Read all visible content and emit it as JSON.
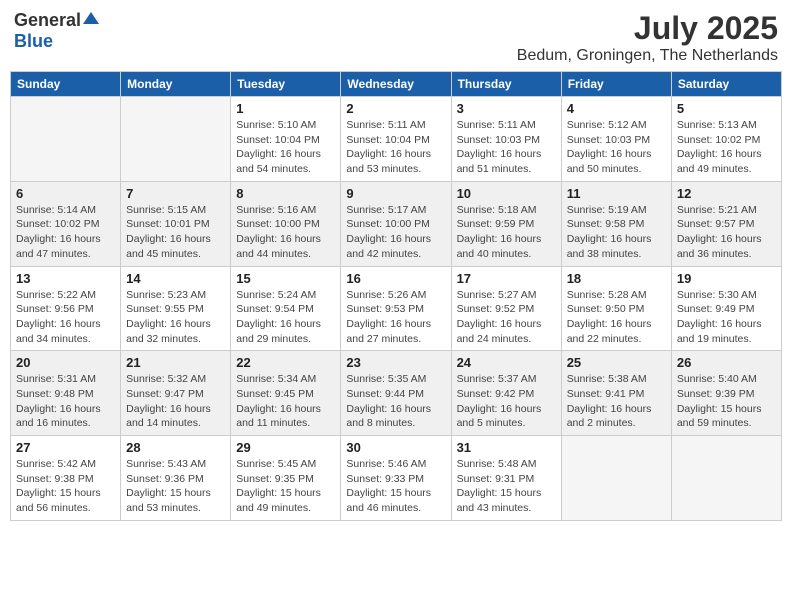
{
  "logo": {
    "general": "General",
    "blue": "Blue"
  },
  "title": "July 2025",
  "subtitle": "Bedum, Groningen, The Netherlands",
  "days_header": [
    "Sunday",
    "Monday",
    "Tuesday",
    "Wednesday",
    "Thursday",
    "Friday",
    "Saturday"
  ],
  "weeks": [
    [
      {
        "day": "",
        "info": ""
      },
      {
        "day": "",
        "info": ""
      },
      {
        "day": "1",
        "info": "Sunrise: 5:10 AM\nSunset: 10:04 PM\nDaylight: 16 hours\nand 54 minutes."
      },
      {
        "day": "2",
        "info": "Sunrise: 5:11 AM\nSunset: 10:04 PM\nDaylight: 16 hours\nand 53 minutes."
      },
      {
        "day": "3",
        "info": "Sunrise: 5:11 AM\nSunset: 10:03 PM\nDaylight: 16 hours\nand 51 minutes."
      },
      {
        "day": "4",
        "info": "Sunrise: 5:12 AM\nSunset: 10:03 PM\nDaylight: 16 hours\nand 50 minutes."
      },
      {
        "day": "5",
        "info": "Sunrise: 5:13 AM\nSunset: 10:02 PM\nDaylight: 16 hours\nand 49 minutes."
      }
    ],
    [
      {
        "day": "6",
        "info": "Sunrise: 5:14 AM\nSunset: 10:02 PM\nDaylight: 16 hours\nand 47 minutes."
      },
      {
        "day": "7",
        "info": "Sunrise: 5:15 AM\nSunset: 10:01 PM\nDaylight: 16 hours\nand 45 minutes."
      },
      {
        "day": "8",
        "info": "Sunrise: 5:16 AM\nSunset: 10:00 PM\nDaylight: 16 hours\nand 44 minutes."
      },
      {
        "day": "9",
        "info": "Sunrise: 5:17 AM\nSunset: 10:00 PM\nDaylight: 16 hours\nand 42 minutes."
      },
      {
        "day": "10",
        "info": "Sunrise: 5:18 AM\nSunset: 9:59 PM\nDaylight: 16 hours\nand 40 minutes."
      },
      {
        "day": "11",
        "info": "Sunrise: 5:19 AM\nSunset: 9:58 PM\nDaylight: 16 hours\nand 38 minutes."
      },
      {
        "day": "12",
        "info": "Sunrise: 5:21 AM\nSunset: 9:57 PM\nDaylight: 16 hours\nand 36 minutes."
      }
    ],
    [
      {
        "day": "13",
        "info": "Sunrise: 5:22 AM\nSunset: 9:56 PM\nDaylight: 16 hours\nand 34 minutes."
      },
      {
        "day": "14",
        "info": "Sunrise: 5:23 AM\nSunset: 9:55 PM\nDaylight: 16 hours\nand 32 minutes."
      },
      {
        "day": "15",
        "info": "Sunrise: 5:24 AM\nSunset: 9:54 PM\nDaylight: 16 hours\nand 29 minutes."
      },
      {
        "day": "16",
        "info": "Sunrise: 5:26 AM\nSunset: 9:53 PM\nDaylight: 16 hours\nand 27 minutes."
      },
      {
        "day": "17",
        "info": "Sunrise: 5:27 AM\nSunset: 9:52 PM\nDaylight: 16 hours\nand 24 minutes."
      },
      {
        "day": "18",
        "info": "Sunrise: 5:28 AM\nSunset: 9:50 PM\nDaylight: 16 hours\nand 22 minutes."
      },
      {
        "day": "19",
        "info": "Sunrise: 5:30 AM\nSunset: 9:49 PM\nDaylight: 16 hours\nand 19 minutes."
      }
    ],
    [
      {
        "day": "20",
        "info": "Sunrise: 5:31 AM\nSunset: 9:48 PM\nDaylight: 16 hours\nand 16 minutes."
      },
      {
        "day": "21",
        "info": "Sunrise: 5:32 AM\nSunset: 9:47 PM\nDaylight: 16 hours\nand 14 minutes."
      },
      {
        "day": "22",
        "info": "Sunrise: 5:34 AM\nSunset: 9:45 PM\nDaylight: 16 hours\nand 11 minutes."
      },
      {
        "day": "23",
        "info": "Sunrise: 5:35 AM\nSunset: 9:44 PM\nDaylight: 16 hours\nand 8 minutes."
      },
      {
        "day": "24",
        "info": "Sunrise: 5:37 AM\nSunset: 9:42 PM\nDaylight: 16 hours\nand 5 minutes."
      },
      {
        "day": "25",
        "info": "Sunrise: 5:38 AM\nSunset: 9:41 PM\nDaylight: 16 hours\nand 2 minutes."
      },
      {
        "day": "26",
        "info": "Sunrise: 5:40 AM\nSunset: 9:39 PM\nDaylight: 15 hours\nand 59 minutes."
      }
    ],
    [
      {
        "day": "27",
        "info": "Sunrise: 5:42 AM\nSunset: 9:38 PM\nDaylight: 15 hours\nand 56 minutes."
      },
      {
        "day": "28",
        "info": "Sunrise: 5:43 AM\nSunset: 9:36 PM\nDaylight: 15 hours\nand 53 minutes."
      },
      {
        "day": "29",
        "info": "Sunrise: 5:45 AM\nSunset: 9:35 PM\nDaylight: 15 hours\nand 49 minutes."
      },
      {
        "day": "30",
        "info": "Sunrise: 5:46 AM\nSunset: 9:33 PM\nDaylight: 15 hours\nand 46 minutes."
      },
      {
        "day": "31",
        "info": "Sunrise: 5:48 AM\nSunset: 9:31 PM\nDaylight: 15 hours\nand 43 minutes."
      },
      {
        "day": "",
        "info": ""
      },
      {
        "day": "",
        "info": ""
      }
    ]
  ]
}
